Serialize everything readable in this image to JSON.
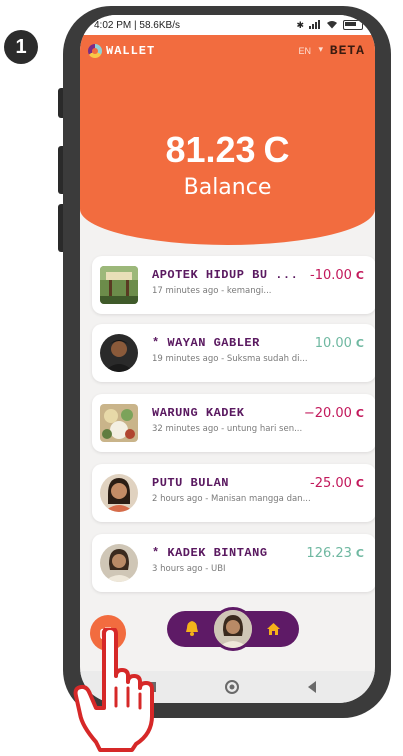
{
  "step_number": "1",
  "status_bar": {
    "time_speed": "4:02 PM | 58.6KB/s"
  },
  "header": {
    "app_title": "WALLET",
    "language": "EN",
    "beta_label": "BETA",
    "balance_value": "81.23",
    "currency_symbol": "C",
    "balance_label": "Balance"
  },
  "transactions": [
    {
      "name": "APOTEK HIDUP BU ...",
      "subtitle": "17 minutes ago - kemangi...",
      "amount": "-10.00",
      "currency": "C",
      "direction": "debit"
    },
    {
      "name": "* WAYAN GABLER",
      "subtitle": "19 minutes ago - Suksma sudah di...",
      "amount": "10.00",
      "currency": "C",
      "direction": "credit"
    },
    {
      "name": "WARUNG KADEK",
      "subtitle": "32 minutes ago - untung hari sen...",
      "amount": "−20.00",
      "currency": "C",
      "direction": "debit"
    },
    {
      "name": "PUTU BULAN",
      "subtitle": "2 hours ago - Manisan mangga dan...",
      "amount": "-25.00",
      "currency": "C",
      "direction": "debit"
    },
    {
      "name": "* KADEK BINTANG",
      "subtitle": "3 hours ago - UBI",
      "amount": "126.23",
      "currency": "C",
      "direction": "credit"
    }
  ],
  "colors": {
    "header_orange": "#f26c3f",
    "nav_purple": "#5e1a66",
    "debit": "#c2185b",
    "credit": "#6fb8a1"
  },
  "icons": [
    "camera-icon",
    "bell-icon",
    "home-icon",
    "pointing-hand-icon"
  ]
}
